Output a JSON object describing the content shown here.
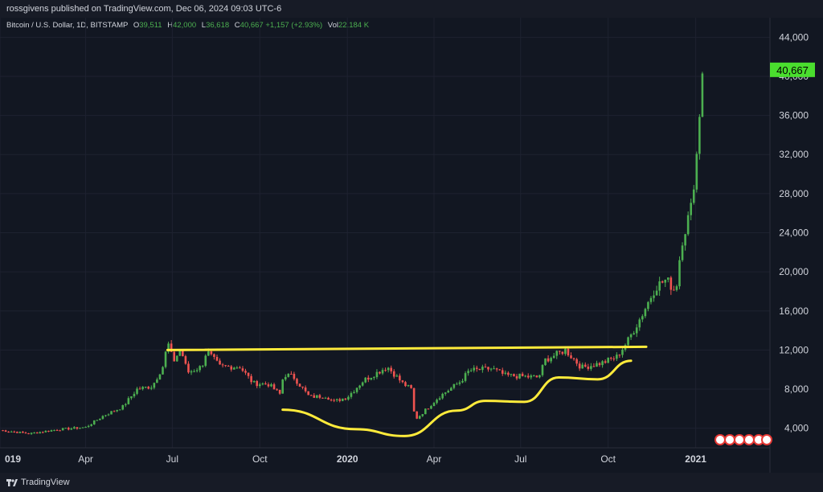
{
  "header": {
    "published": "rossgivens published on TradingView.com, Dec 06, 2024 09:03 UTC-6"
  },
  "legend": {
    "symbol": "Bitcoin / U.S. Dollar, 1D, BITSTAMP",
    "o_label": "O",
    "o_value": "39,511",
    "h_label": "H",
    "h_value": "42,000",
    "l_label": "L",
    "l_value": "36,618",
    "c_label": "C",
    "c_value": "40,667",
    "change": "+1,157 (+2.93%)",
    "vol_label": "Vol",
    "vol_value": "22.184 K"
  },
  "footer": {
    "brand": "TradingView"
  },
  "colors": {
    "background": "#121722",
    "up": "#4caf50",
    "down": "#ef5350",
    "annotation": "#ffeb3b",
    "price_tag": "#4ade2e"
  },
  "chart_data": {
    "type": "candlestick",
    "symbol": "Bitcoin / U.S. Dollar",
    "interval": "1D",
    "exchange": "BITSTAMP",
    "ylim": [
      2000,
      46000
    ],
    "y_ticks": [
      4000,
      8000,
      12000,
      16000,
      20000,
      24000,
      28000,
      32000,
      36000,
      40000,
      44000
    ],
    "y_tick_labels": [
      "4,000",
      "8,000",
      "12,000",
      "16,000",
      "20,000",
      "24,000",
      "28,000",
      "32,000",
      "36,000",
      "40,000",
      "44,000"
    ],
    "x_range": [
      "2019-01-01",
      "2021-03-20"
    ],
    "x_ticks": [
      {
        "date": "2019-01-01",
        "label": "019",
        "bold": true
      },
      {
        "date": "2019-04-01",
        "label": "Apr",
        "bold": false
      },
      {
        "date": "2019-07-01",
        "label": "Jul",
        "bold": false
      },
      {
        "date": "2019-10-01",
        "label": "Oct",
        "bold": false
      },
      {
        "date": "2020-01-01",
        "label": "2020",
        "bold": true
      },
      {
        "date": "2020-04-01",
        "label": "Apr",
        "bold": false
      },
      {
        "date": "2020-07-01",
        "label": "Jul",
        "bold": false
      },
      {
        "date": "2020-10-01",
        "label": "Oct",
        "bold": false
      },
      {
        "date": "2021-01-01",
        "label": "2021",
        "bold": true
      }
    ],
    "last_price": 40667,
    "last_price_label": "40,667",
    "close_path": [
      [
        "2019-01-01",
        3800
      ],
      [
        "2019-02-01",
        3450
      ],
      [
        "2019-03-01",
        3850
      ],
      [
        "2019-04-01",
        4100
      ],
      [
        "2019-04-20",
        5300
      ],
      [
        "2019-05-10",
        6200
      ],
      [
        "2019-05-25",
        8000
      ],
      [
        "2019-06-10",
        8300
      ],
      [
        "2019-06-22",
        10500
      ],
      [
        "2019-06-26",
        12900
      ],
      [
        "2019-07-02",
        10800
      ],
      [
        "2019-07-10",
        12100
      ],
      [
        "2019-07-17",
        9700
      ],
      [
        "2019-08-01",
        10300
      ],
      [
        "2019-08-06",
        11900
      ],
      [
        "2019-08-20",
        10300
      ],
      [
        "2019-09-10",
        10300
      ],
      [
        "2019-09-24",
        8600
      ],
      [
        "2019-10-10",
        8500
      ],
      [
        "2019-10-22",
        7500
      ],
      [
        "2019-10-26",
        9500
      ],
      [
        "2019-11-05",
        9300
      ],
      [
        "2019-11-22",
        7200
      ],
      [
        "2019-12-10",
        7300
      ],
      [
        "2019-12-17",
        6700
      ],
      [
        "2020-01-01",
        7200
      ],
      [
        "2020-01-18",
        8900
      ],
      [
        "2020-02-12",
        10300
      ],
      [
        "2020-02-28",
        8600
      ],
      [
        "2020-03-08",
        8000
      ],
      [
        "2020-03-12",
        4900
      ],
      [
        "2020-03-16",
        5200
      ],
      [
        "2020-04-06",
        7200
      ],
      [
        "2020-04-29",
        8800
      ],
      [
        "2020-05-08",
        9900
      ],
      [
        "2020-06-01",
        10100
      ],
      [
        "2020-06-15",
        9400
      ],
      [
        "2020-07-20",
        9200
      ],
      [
        "2020-07-27",
        11000
      ],
      [
        "2020-08-17",
        12000
      ],
      [
        "2020-09-03",
        10200
      ],
      [
        "2020-09-25",
        10700
      ],
      [
        "2020-10-10",
        11300
      ],
      [
        "2020-10-22",
        13000
      ],
      [
        "2020-11-05",
        15500
      ],
      [
        "2020-11-20",
        18500
      ],
      [
        "2020-12-01",
        19200
      ],
      [
        "2020-12-11",
        18000
      ],
      [
        "2020-12-17",
        23000
      ],
      [
        "2020-12-27",
        26500
      ],
      [
        "2021-01-02",
        32000
      ],
      [
        "2021-01-08",
        40667
      ]
    ],
    "annotations": [
      {
        "kind": "horizontal-line",
        "from": "2019-06-26",
        "to": "2020-11-10",
        "value": 12000
      },
      {
        "kind": "cup-curve",
        "points": [
          [
            "2019-10-25",
            5900
          ],
          [
            "2020-01-10",
            3900
          ],
          [
            "2020-03-01",
            3200
          ],
          [
            "2020-04-25",
            5800
          ],
          [
            "2020-05-25",
            6800
          ],
          [
            "2020-07-05",
            6700
          ],
          [
            "2020-08-10",
            9200
          ],
          [
            "2020-09-20",
            9000
          ],
          [
            "2020-10-25",
            10900
          ]
        ]
      }
    ]
  }
}
